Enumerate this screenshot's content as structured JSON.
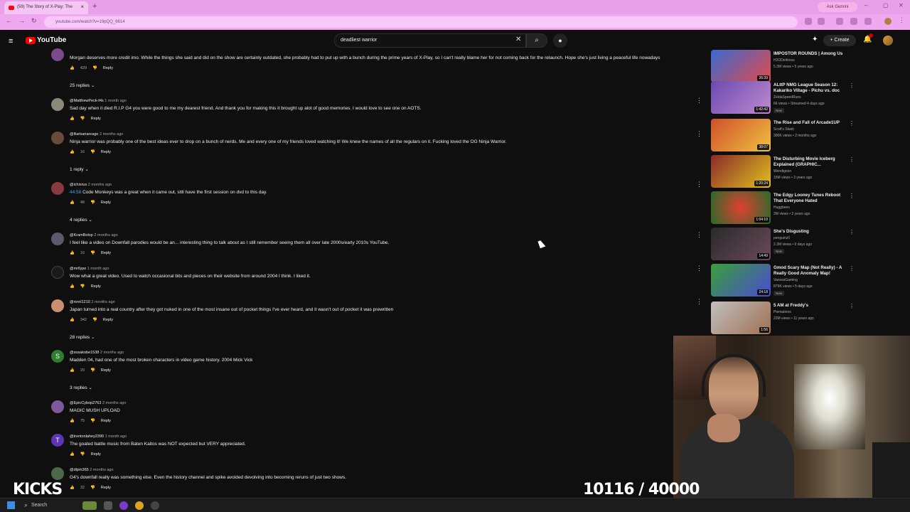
{
  "browser": {
    "tab_title": "(59) The Story of X-Play: The",
    "new_tab": "+",
    "ask_gemini": "Ask Gemini",
    "url": "youtube.com/watch?v=19pQQ_6614"
  },
  "youtube": {
    "logo_text": "YouTube",
    "search_value": "deadliest warrior",
    "create_label": "Create"
  },
  "comments": [
    {
      "author": "",
      "age": "",
      "text": "Morgan deserves more credit imo. While the things she said and did on the show are certainly outdated, she probably had to put up with a bunch during the prime years of X-Play, so I can't really blame her for not coming back for the relaunch. Hope she's just living a peaceful life nowadays",
      "likes": "429",
      "reply": "Reply",
      "replies": "25 replies"
    },
    {
      "author": "@MatthewPeck-f4s",
      "age": "1 month ago",
      "text": "Sad day when it died R.I.P G4 you were good to me my dearest friend. And thank you for making this it brought up alot of good memories. I would love to see one on AOTS.",
      "likes": "",
      "reply": "Reply",
      "replies": ""
    },
    {
      "author": "@Barbarianrage",
      "age": "2 months ago",
      "text": "Ninja warrior was probably one of the best ideas ever to drop on a bunch of nerds. Me and every one of my friends loved watching it! We knew the names of all the regulars on it. Fucking loved the OG Ninja Warrior.",
      "likes": "16",
      "reply": "Reply",
      "replies": "1 reply"
    },
    {
      "author": "@ichisrus",
      "age": "2 months ago",
      "timestamp": "44:58",
      "text": " Code Monkeys was a great when it came out, still have the first session on dvd to this day.",
      "likes": "48",
      "reply": "Reply",
      "replies": "4 replies"
    },
    {
      "author": "@KramBolop",
      "age": "2 months ago",
      "text": "I feel like a video on Downfall parodies would be an... interesting thing to talk about as I still remember seeing them all over late 2000s/early 2010s YouTube.",
      "likes": "16",
      "reply": "Reply",
      "replies": ""
    },
    {
      "author": "@mrllype",
      "age": "1 month ago",
      "text": "Wow what a great video. Used to watch occasional bits and pieces on their website from around 2004 I think. I liked it.",
      "likes": "",
      "reply": "Reply",
      "replies": ""
    },
    {
      "author": "@rorol1210",
      "age": "2 months ago",
      "text": "Japan turned into a real country after they got nuked in one of the most insane out of pocket things I've ever heard, and it wasn't out of pocket it was prewritten",
      "likes": "342",
      "reply": "Reply",
      "replies": "28 replies"
    },
    {
      "author": "@sosakobe1538",
      "age": "2 months ago",
      "text": "Madden 04, had one of the most broken characters in video game history. 2004 Mick Vick",
      "likes": "20",
      "reply": "Reply",
      "replies": "3 replies"
    },
    {
      "author": "@EpicCybop2763",
      "age": "2 months ago",
      "text": "MAGIC MUSH UPLOAD",
      "likes": "75",
      "reply": "Reply",
      "replies": ""
    },
    {
      "author": "@trentonlahey2390",
      "age": "1 month ago",
      "text": "The goated battle music from Baten Kaitos was NOT expected but VERY appreciated.",
      "likes": "",
      "reply": "Reply",
      "replies": ""
    },
    {
      "author": "@dlpm365",
      "age": "2 months ago",
      "text": "G4's downfall really was something else. Even the history channel and spike avoided devolving into becoming reruns of just two shows.",
      "likes": "32",
      "reply": "Reply",
      "replies": ""
    }
  ],
  "comment_avatar_letters": {
    "s": "S",
    "t": "T"
  },
  "sidebar": [
    {
      "title": "IMPOSTOR ROUNDS | Among Us",
      "channel": "H2ODelirious",
      "stats": "5.3M views • 5 years ago",
      "duration": "26:39",
      "badge": ""
    },
    {
      "title": "ALttP NMG League Season 12: Kakariko Village - Pichu vs. doc",
      "channel": "ZeldaSpeedRuns",
      "stats": "66 views • Streamed 4 days ago",
      "duration": "1:42:42",
      "badge": "New"
    },
    {
      "title": "The Rise and Fall of Arcade1UP",
      "channel": "Scott's Stash",
      "stats": "300K views • 2 months ago",
      "duration": "38:07",
      "badge": ""
    },
    {
      "title": "The Disturbing Movie Iceberg Explained (GRAPHIC...",
      "channel": "Wendigoon",
      "stats": "15M views • 3 years ago",
      "duration": "1:20:24",
      "badge": ""
    },
    {
      "title": "The Edgy Looney Tunes Reboot That Everyone Hated",
      "channel": "Huggbees",
      "stats": "2M views • 2 years ago",
      "duration": "1:04:10",
      "badge": ""
    },
    {
      "title": "She's Disgusting",
      "channel": "penguinz0",
      "stats": "2.3M views • 6 days ago",
      "duration": "14:49",
      "badge": "New"
    },
    {
      "title": "Gmod Scary Map (Not Really) - A Really Good Anomaly Map!",
      "channel": "VanossGaming",
      "stats": "879K views • 5 days ago",
      "duration": "24:18",
      "badge": "New"
    },
    {
      "title": "5 AM at Freddy's",
      "channel": "Piemations",
      "stats": "22M views • 11 years ago",
      "duration": "1:56",
      "badge": ""
    }
  ],
  "overlay": {
    "brand": "KICKS",
    "sub_counter": "10116 / 40000"
  },
  "taskbar": {
    "search_label": "Search"
  },
  "icons": {
    "hamburger": "≡",
    "clear": "✕",
    "search": "⌕",
    "mic": "🎙",
    "kebab": "⋮",
    "like": "👍",
    "dislike": "👎",
    "chevron": "⌄"
  }
}
